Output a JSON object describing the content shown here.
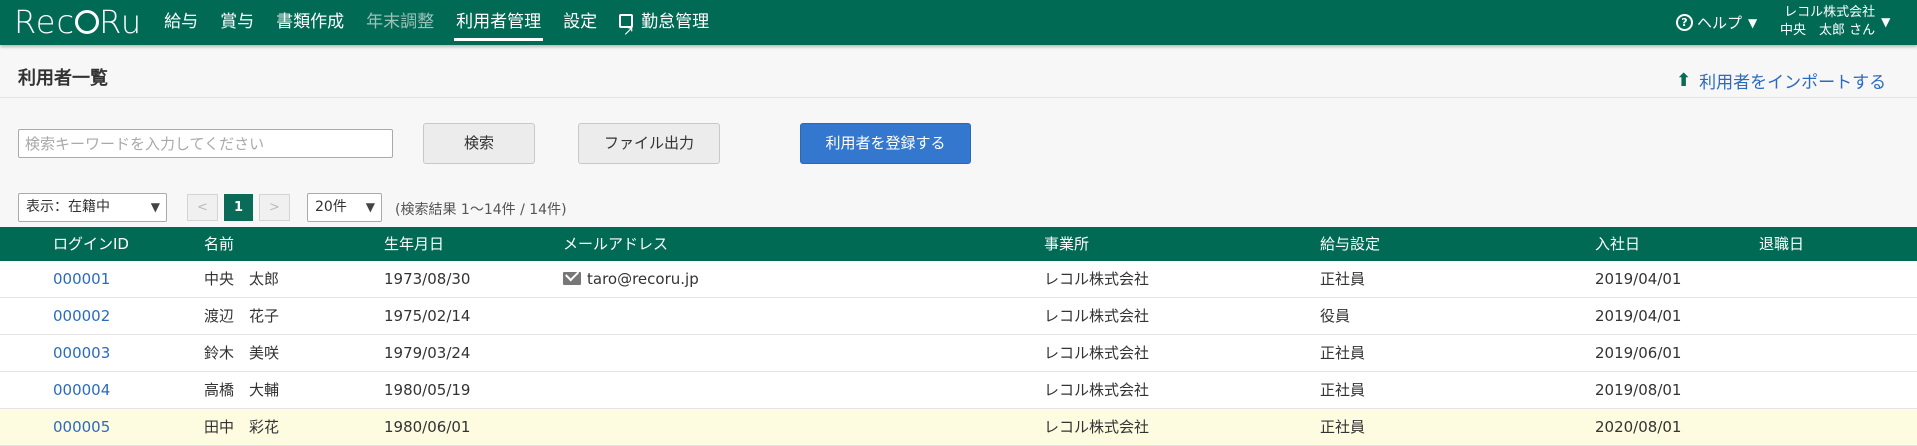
{
  "app": {
    "logo_text": "RecoRu"
  },
  "nav": {
    "items": [
      {
        "label": "給与"
      },
      {
        "label": "賞与"
      },
      {
        "label": "書類作成"
      },
      {
        "label": "年末調整"
      },
      {
        "label": "利用者管理"
      },
      {
        "label": "設定"
      },
      {
        "label": "勤怠管理"
      }
    ],
    "help_label": "ヘルプ",
    "company": "レコル株式会社",
    "user_name": "中央　太郎 さん"
  },
  "page": {
    "title": "利用者一覧",
    "import_link": "利用者をインポートする"
  },
  "search": {
    "placeholder": "検索キーワードを入力してください",
    "search_button": "検索",
    "export_button": "ファイル出力",
    "register_button": "利用者を登録する"
  },
  "pager": {
    "status_select": "表示：在籍中",
    "prev": "<",
    "current_page": "1",
    "next": ">",
    "per_page": "20件",
    "result_info": "(検索結果 1〜14件 / 14件)"
  },
  "table": {
    "headers": {
      "login_id": "ログインID",
      "name": "名前",
      "birth": "生年月日",
      "email": "メールアドレス",
      "office": "事業所",
      "salary": "給与設定",
      "join": "入社日",
      "leave": "退職日"
    },
    "rows": [
      {
        "login_id": "000001",
        "name": "中央　太郎",
        "birth": "1973/08/30",
        "email": "taro@recoru.jp",
        "office": "レコル株式会社",
        "salary": "正社員",
        "join": "2019/04/01",
        "leave": ""
      },
      {
        "login_id": "000002",
        "name": "渡辺　花子",
        "birth": "1975/02/14",
        "email": "",
        "office": "レコル株式会社",
        "salary": "役員",
        "join": "2019/04/01",
        "leave": ""
      },
      {
        "login_id": "000003",
        "name": "鈴木　美咲",
        "birth": "1979/03/24",
        "email": "",
        "office": "レコル株式会社",
        "salary": "正社員",
        "join": "2019/06/01",
        "leave": ""
      },
      {
        "login_id": "000004",
        "name": "高橋　大輔",
        "birth": "1980/05/19",
        "email": "",
        "office": "レコル株式会社",
        "salary": "正社員",
        "join": "2019/08/01",
        "leave": ""
      },
      {
        "login_id": "000005",
        "name": "田中　彩花",
        "birth": "1980/06/01",
        "email": "",
        "office": "レコル株式会社",
        "salary": "正社員",
        "join": "2020/08/01",
        "leave": ""
      }
    ]
  },
  "colors": {
    "primary": "#006a55",
    "link": "#2a6bbf",
    "register_button": "#3477cf",
    "highlight_row": "#fdfbe0"
  }
}
